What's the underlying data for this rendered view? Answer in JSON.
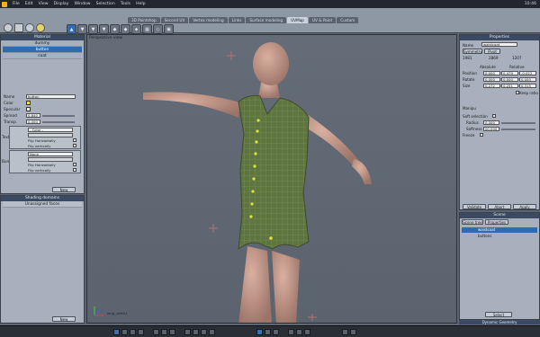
{
  "menubar": {
    "items": [
      "File",
      "Edit",
      "View",
      "Display",
      "Window",
      "Selection",
      "Tools",
      "Help"
    ],
    "clock": "10:46"
  },
  "room_tabs": [
    "3D Paintshop",
    "Second UV",
    "Vertex modeling",
    "Links",
    "Surface modeling",
    "UVMap",
    "UV & Paint",
    "Custom"
  ],
  "active_room_tab": "UVMap",
  "toolbar": {
    "world_select": "World",
    "group_label": "Group: Group all",
    "tool_labels": [
      "LOOP",
      "ALL",
      "SHAPE",
      "BRUSH",
      "POINT",
      "SCALE"
    ]
  },
  "material_panel": {
    "title": "Material",
    "items": [
      "dummy",
      "button",
      "coat"
    ],
    "selected": "button",
    "name_label": "Name",
    "name_value": "button",
    "color_label": "Color",
    "color": "#e6e633",
    "specular_label": "Specular",
    "specular_color": "#f4f4d6",
    "spread_label": "Spread",
    "spread_value": "0.840",
    "transp_label": "Transp.",
    "transp_value": "0.000",
    "texture_label": "Texture",
    "texture_select": "- Color -",
    "bump_label": "Bump",
    "bump_select": "None",
    "flip_h_label": "Flip Horizontally",
    "flip_v_label": "Flip vertically",
    "new_button": "New"
  },
  "shading_panel": {
    "title": "Shading domains",
    "items": [
      "Unassigned faces"
    ],
    "new_button": "New"
  },
  "viewport": {
    "title": "Perspective view",
    "label": "long_vert01"
  },
  "properties_panel": {
    "title": "Properties",
    "name_label": "Name",
    "name_value": "waistcoat",
    "tabs": [
      "Symmetry",
      "Pivot"
    ],
    "counts": [
      "1981",
      "2869",
      "1207"
    ],
    "absolute_label": "Absolute",
    "relative_label": "Relative",
    "position_label": "Position",
    "position": [
      "0.000",
      "0.479",
      "-0.022"
    ],
    "rotate_label": "Rotate",
    "rotate": [
      "0.000",
      "0.000",
      "0.000"
    ],
    "size_label": "Size",
    "size": [
      "0.272",
      "0.251",
      "0.315"
    ],
    "keep_ratio_label": "Keep ratio",
    "manipu_label": "Manipu",
    "soft_selection_label": "Soft selection",
    "radius_label": "Radius",
    "radius_value": "0.000",
    "softness_label": "Softness",
    "softness_value": "00.000",
    "freeze_label": "Freeze",
    "buttons": [
      "Validate",
      "Abort",
      "Apply"
    ]
  },
  "scene_panel": {
    "title": "Scene",
    "tabs": [
      "Scene tree",
      "Properties"
    ],
    "items": [
      "waistcoat",
      "buttons"
    ],
    "selected": "waistcoat",
    "select_button": "Select"
  },
  "shapes_tab": "Dynamic Geometry",
  "icons": [
    "search-icon",
    "move-icon",
    "rotate-icon",
    "scale-icon",
    "lock-icon"
  ]
}
